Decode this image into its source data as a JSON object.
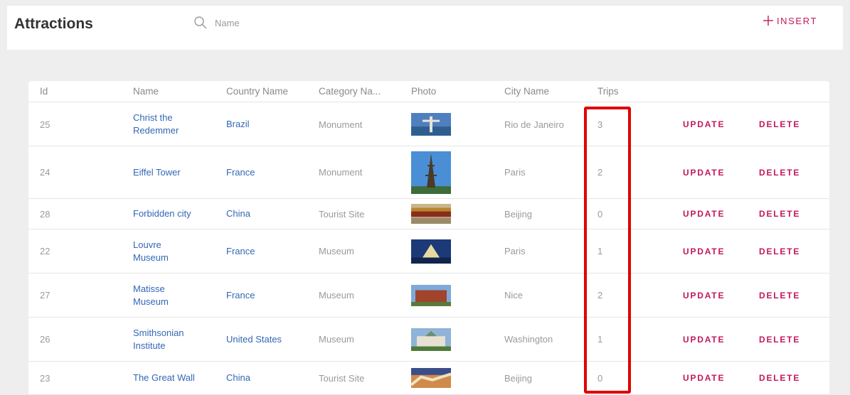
{
  "app": {
    "title": "Attractions",
    "search_placeholder": "Name",
    "insert_label": "INSERT",
    "accent_color": "#c2185b",
    "link_color": "#3367b5",
    "highlight_color": "#e00000"
  },
  "table": {
    "headers": {
      "id": "Id",
      "name": "Name",
      "country": "Country Name",
      "category": "Category Na...",
      "photo": "Photo",
      "city": "City Name",
      "trips": "Trips"
    },
    "update_label": "UPDATE",
    "delete_label": "DELETE",
    "rows": [
      {
        "id": "25",
        "name": "Christ the Redemmer",
        "country": "Brazil",
        "category": "Monument",
        "photo": "christ-redeemer-photo",
        "city": "Rio de Janeiro",
        "trips": "3"
      },
      {
        "id": "24",
        "name": "Eiffel Tower",
        "country": "France",
        "category": "Monument",
        "photo": "eiffel-tower-photo",
        "city": "Paris",
        "trips": "2"
      },
      {
        "id": "28",
        "name": "Forbidden city",
        "country": "China",
        "category": "Tourist Site",
        "photo": "forbidden-city-photo",
        "city": "Beijing",
        "trips": "0"
      },
      {
        "id": "22",
        "name": "Louvre Museum",
        "country": "France",
        "category": "Museum",
        "photo": "louvre-photo",
        "city": "Paris",
        "trips": "1"
      },
      {
        "id": "27",
        "name": "Matisse Museum",
        "country": "France",
        "category": "Museum",
        "photo": "matisse-museum-photo",
        "city": "Nice",
        "trips": "2"
      },
      {
        "id": "26",
        "name": "Smithsonian Institute",
        "country": "United States",
        "category": "Museum",
        "photo": "smithsonian-photo",
        "city": "Washington",
        "trips": "1"
      },
      {
        "id": "23",
        "name": "The Great Wall",
        "country": "China",
        "category": "Tourist Site",
        "photo": "great-wall-photo",
        "city": "Beijing",
        "trips": "0"
      }
    ]
  }
}
